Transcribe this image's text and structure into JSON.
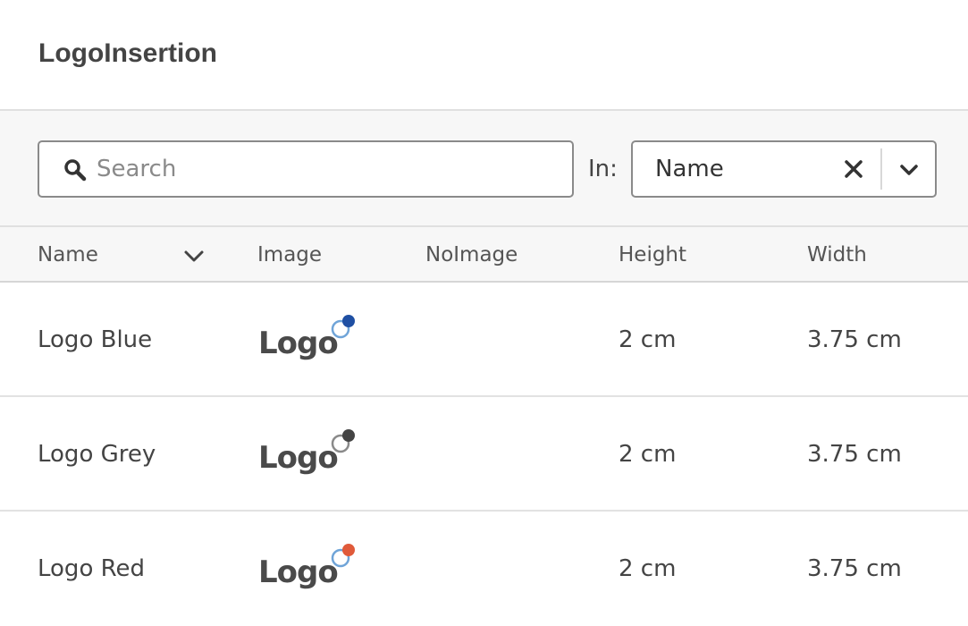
{
  "header": {
    "title": "LogoInsertion"
  },
  "filter": {
    "search_placeholder": "Search",
    "search_value": "",
    "in_label": "In:",
    "field_value": "Name"
  },
  "table": {
    "columns": [
      "Name",
      "Image",
      "NoImage",
      "Height",
      "Width"
    ],
    "rows": [
      {
        "name": "Logo Blue",
        "logo_text": "Logo",
        "logo_accent": "#1f4fa3",
        "no_image": "",
        "height": "2 cm",
        "width": "3.75 cm"
      },
      {
        "name": "Logo Grey",
        "logo_text": "Logo",
        "logo_accent": "#444444",
        "no_image": "",
        "height": "2 cm",
        "width": "3.75 cm"
      },
      {
        "name": "Logo Red",
        "logo_text": "Logo",
        "logo_accent": "#e05a3a",
        "no_image": "",
        "height": "2 cm",
        "width": "3.75 cm"
      }
    ]
  },
  "colors": {
    "ring_blue": "#6fa4d8",
    "ring_grey": "#8a8a8a"
  },
  "icons": {
    "search": "search-icon",
    "clear": "close-icon",
    "dropdown": "chevron-down-icon",
    "sort": "chevron-down-icon"
  }
}
